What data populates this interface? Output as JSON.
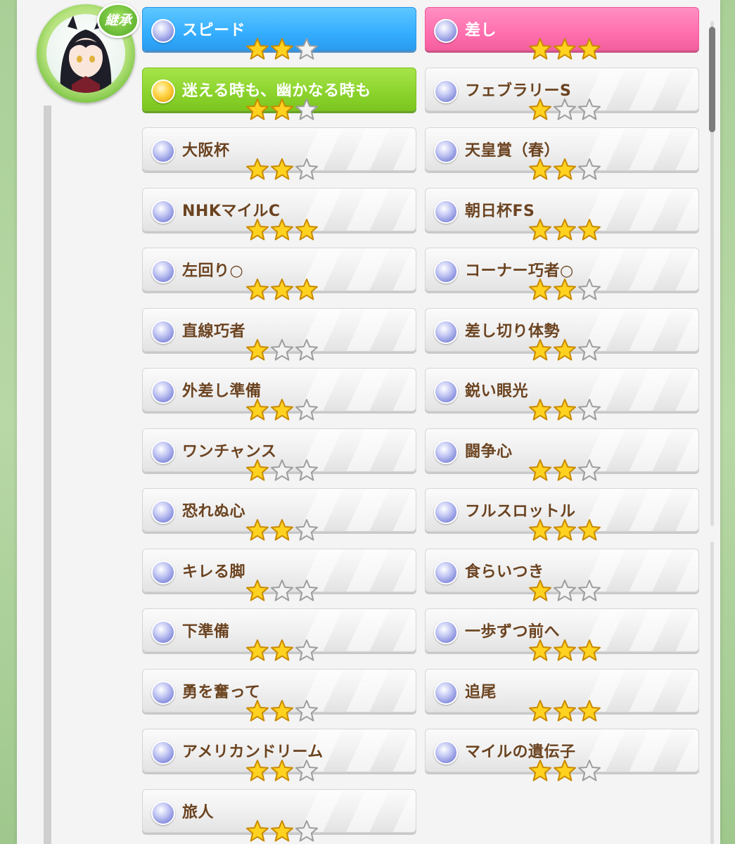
{
  "avatar": {
    "badge_label": "継承"
  },
  "skills": [
    {
      "label": "スピード",
      "stars": 2,
      "style": "blue"
    },
    {
      "label": "差し",
      "stars": 3,
      "style": "pink"
    },
    {
      "label": "迷える時も、幽かなる時も",
      "stars": 2,
      "style": "green",
      "orb": "gold"
    },
    {
      "label": "フェブラリーS",
      "stars": 1,
      "style": "white"
    },
    {
      "label": "大阪杯",
      "stars": 2,
      "style": "white"
    },
    {
      "label": "天皇賞（春）",
      "stars": 2,
      "style": "white"
    },
    {
      "label": "NHKマイルC",
      "stars": 3,
      "style": "white"
    },
    {
      "label": "朝日杯FS",
      "stars": 3,
      "style": "white"
    },
    {
      "label": "左回り○",
      "stars": 3,
      "style": "white"
    },
    {
      "label": "コーナー巧者○",
      "stars": 2,
      "style": "white"
    },
    {
      "label": "直線巧者",
      "stars": 1,
      "style": "white"
    },
    {
      "label": "差し切り体勢",
      "stars": 2,
      "style": "white"
    },
    {
      "label": "外差し準備",
      "stars": 2,
      "style": "white"
    },
    {
      "label": "鋭い眼光",
      "stars": 2,
      "style": "white"
    },
    {
      "label": "ワンチャンス",
      "stars": 1,
      "style": "white"
    },
    {
      "label": "闘争心",
      "stars": 2,
      "style": "white"
    },
    {
      "label": "恐れぬ心",
      "stars": 2,
      "style": "white"
    },
    {
      "label": "フルスロットル",
      "stars": 3,
      "style": "white"
    },
    {
      "label": "キレる脚",
      "stars": 1,
      "style": "white"
    },
    {
      "label": "食らいつき",
      "stars": 1,
      "style": "white"
    },
    {
      "label": "下準備",
      "stars": 2,
      "style": "white"
    },
    {
      "label": "一歩ずつ前へ",
      "stars": 3,
      "style": "white"
    },
    {
      "label": "勇を奮って",
      "stars": 2,
      "style": "white"
    },
    {
      "label": "追尾",
      "stars": 3,
      "style": "white"
    },
    {
      "label": "アメリカンドリーム",
      "stars": 2,
      "style": "white"
    },
    {
      "label": "マイルの遺伝子",
      "stars": 2,
      "style": "white"
    },
    {
      "label": "旅人",
      "stars": 2,
      "style": "white"
    }
  ],
  "max_stars": 3,
  "colors": {
    "star_filled": "#ffd21f",
    "star_empty": "#f2f2f2",
    "label_brown": "#6b4320"
  }
}
